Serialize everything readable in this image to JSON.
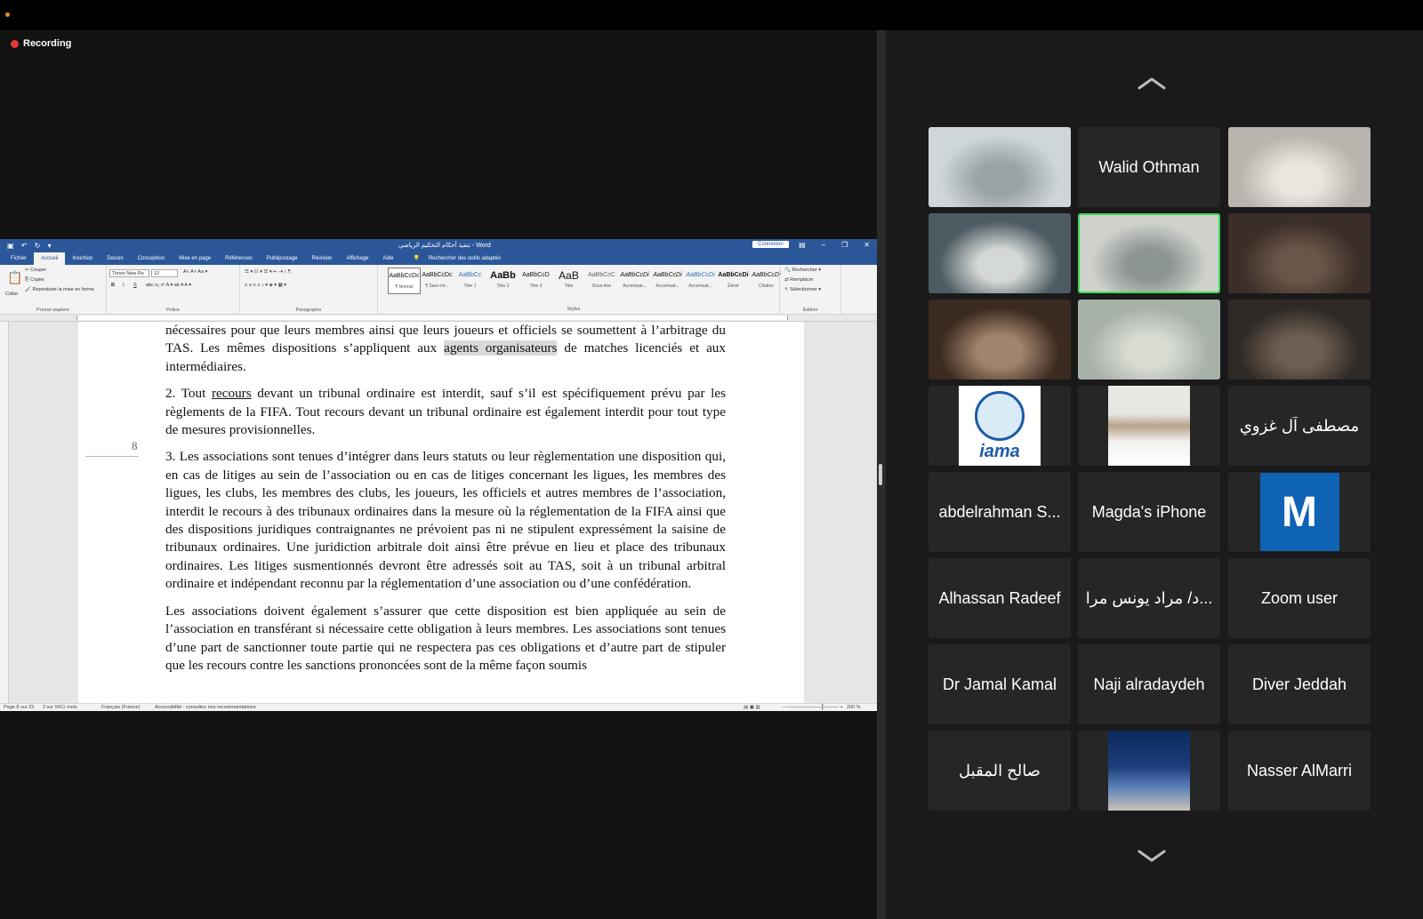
{
  "recording": {
    "label": "Recording"
  },
  "word": {
    "qa_icons": "▣ ↶ ↻ ▾",
    "title": "تنفيذ أحكام التحكيم الرياضي - Word",
    "connexion": "Connexion",
    "window_controls": [
      "▤",
      "–",
      "❐",
      "✕"
    ],
    "tabs": [
      "Fichier",
      "Accueil",
      "Insertion",
      "Dessin",
      "Conception",
      "Mise en page",
      "Références",
      "Publipostage",
      "Révision",
      "Affichage",
      "Aide"
    ],
    "active_tab": "Accueil",
    "tell_me": "Rechercher des outils adaptés",
    "clipboard": {
      "paste": "Coller",
      "cut": "Couper",
      "copy": "Copier",
      "format_painter": "Reproduire la mise en forme",
      "group": "Presse-papiers"
    },
    "font": {
      "name": "Times New Ro",
      "size": "12",
      "group": "Police"
    },
    "paragraph": {
      "group": "Paragraphe"
    },
    "styles": {
      "group": "Styles",
      "items": [
        {
          "sample": "AaBbCcDc",
          "name": "¶ Normal"
        },
        {
          "sample": "AaBbCcDc",
          "name": "¶ Sans int..."
        },
        {
          "sample": "AaBbCc",
          "name": "Titre 1"
        },
        {
          "sample": "AaBb",
          "name": "Titre 2"
        },
        {
          "sample": "AaBbCcD",
          "name": "Titre 3"
        },
        {
          "sample": "AaB",
          "name": "Titre"
        },
        {
          "sample": "AaBbCcC",
          "name": "Sous-titre"
        },
        {
          "sample": "AaBbCcDi",
          "name": "Accentuat..."
        },
        {
          "sample": "AaBbCcDi",
          "name": "Accentuat..."
        },
        {
          "sample": "AaBbCcDi",
          "name": "Accentuat..."
        },
        {
          "sample": "AaBbCcDi",
          "name": "Élevé"
        },
        {
          "sample": "AaBbCcDi",
          "name": "Citation"
        }
      ]
    },
    "editing": {
      "find": "Rechercher",
      "replace": "Remplacer",
      "select": "Sélectionner",
      "group": "Édition"
    },
    "page_number": "8",
    "doc": {
      "p1_a": "nécessaires pour que leurs membres ainsi que leurs joueurs et officiels se soumettent à l’arbitrage du TAS. Les mêmes dispositions s’appliquent aux ",
      "p1_hl": "agents organisateurs",
      "p1_b": " de matches licenciés et aux intermédiaires.",
      "p2_a": "2. Tout ",
      "p2_ul": "recours",
      "p2_b": " devant un tribunal ordinaire est interdit, sauf s’il est spécifiquement prévu par les règlements de la FIFA. Tout recours devant un tribunal ordinaire est également interdit pour tout type de mesures provisionnelles.",
      "p3": "3. Les associations sont tenues d’intégrer dans leurs statuts ou leur règlementation une disposition qui, en cas de litiges au sein de l’association ou en cas de litiges concernant les ligues, les membres des ligues, les clubs, les membres des clubs, les joueurs, les officiels et autres membres de l’association, interdit le recours à des tribunaux ordinaires dans la mesure où la réglementation de la FIFA ainsi que des dispositions juridiques contraignantes ne prévoient pas ni ne stipulent expressément la saisine de tribunaux ordinaires. Une juridiction arbitrale doit ainsi être prévue en lieu et place des tribunaux ordinaires. Les litiges susmentionnés devront être adressés soit au TAS, soit à un tribunal arbitral ordinaire et indépendant reconnu par la réglementation d’une association ou d’une confédération.",
      "p4": "Les associations doivent également s’assurer que cette disposition est bien appliquée au sein de l’association en transférant si nécessaire cette obligation à leurs membres. Les associations sont tenues d’une part de sanctionner toute partie qui ne respectera pas ces obligations et d’autre part de stipuler que les recours contre les sanctions prononcées sont de la même façon soumis"
    },
    "status": {
      "page": "Page 8 sur 23",
      "words": "2 sur 9411 mots",
      "language": "Français (France)",
      "accessibility": "Accessibilité : consultez nos recommandations",
      "zoom": "200 %"
    }
  },
  "gallery": {
    "tiles": [
      {
        "kind": "video",
        "label": ""
      },
      {
        "kind": "name",
        "label": "Walid Othman"
      },
      {
        "kind": "video",
        "label": ""
      },
      {
        "kind": "video",
        "label": ""
      },
      {
        "kind": "video",
        "label": "",
        "active": true
      },
      {
        "kind": "video",
        "label": ""
      },
      {
        "kind": "video",
        "label": ""
      },
      {
        "kind": "video",
        "label": ""
      },
      {
        "kind": "video",
        "label": ""
      },
      {
        "kind": "logo",
        "label": "iama"
      },
      {
        "kind": "photo",
        "label": ""
      },
      {
        "kind": "name",
        "label": "مصطفى آل غزوي"
      },
      {
        "kind": "name",
        "label": "abdelrahman S..."
      },
      {
        "kind": "name",
        "label": "Magda's iPhone"
      },
      {
        "kind": "avatar",
        "label": "M"
      },
      {
        "kind": "name",
        "label": "Alhassan Radeef"
      },
      {
        "kind": "name",
        "label": "د/ مراد يونس مرا..."
      },
      {
        "kind": "name",
        "label": "Zoom user"
      },
      {
        "kind": "name",
        "label": "Dr Jamal Kamal"
      },
      {
        "kind": "name",
        "label": "Naji alradaydeh"
      },
      {
        "kind": "name",
        "label": "Diver Jeddah"
      },
      {
        "kind": "name",
        "label": "صالح المقبل"
      },
      {
        "kind": "photo",
        "label": ""
      },
      {
        "kind": "name",
        "label": "Nasser AlMarri"
      }
    ],
    "colors": {
      "active_speaker": "#3ddc58",
      "tile_bg": "#262626"
    }
  }
}
